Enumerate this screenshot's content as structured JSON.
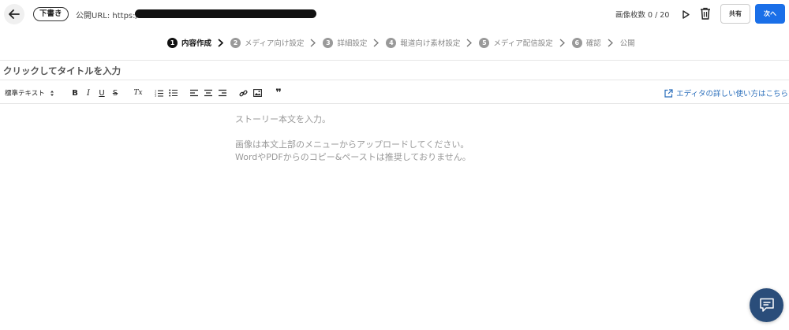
{
  "header": {
    "status_badge": "下書き",
    "public_url_label": "公開URL: https:/",
    "image_count": "画像枚数 0 / 20",
    "share_label": "共有",
    "next_label": "次へ"
  },
  "stepper": {
    "steps": [
      {
        "num": "1",
        "label": "内容作成",
        "active": true
      },
      {
        "num": "2",
        "label": "メディア向け設定",
        "active": false
      },
      {
        "num": "3",
        "label": "詳細設定",
        "active": false
      },
      {
        "num": "4",
        "label": "報道向け素材設定",
        "active": false
      },
      {
        "num": "5",
        "label": "メディア配信設定",
        "active": false
      },
      {
        "num": "6",
        "label": "確認",
        "active": false
      }
    ],
    "final_label": "公開"
  },
  "title": {
    "placeholder": "クリックしてタイトルを入力"
  },
  "toolbar": {
    "text_style": "標準テキスト",
    "bold": "B",
    "italic": "I",
    "underline": "U",
    "strike": "S",
    "clear_format": "Tx",
    "quote": "❞",
    "help_link": "エディタの詳しい使い方はこちら"
  },
  "editor": {
    "line1": "ストーリー本文を入力。",
    "line2": "画像は本文上部のメニューからアップロードしてください。",
    "line3": "WordやPDFからのコピー&ペーストは推奨しておりません。"
  },
  "colors": {
    "accent": "#1a6fe8",
    "link": "#2a6ebb",
    "chat_fab": "#2a4d7a"
  }
}
